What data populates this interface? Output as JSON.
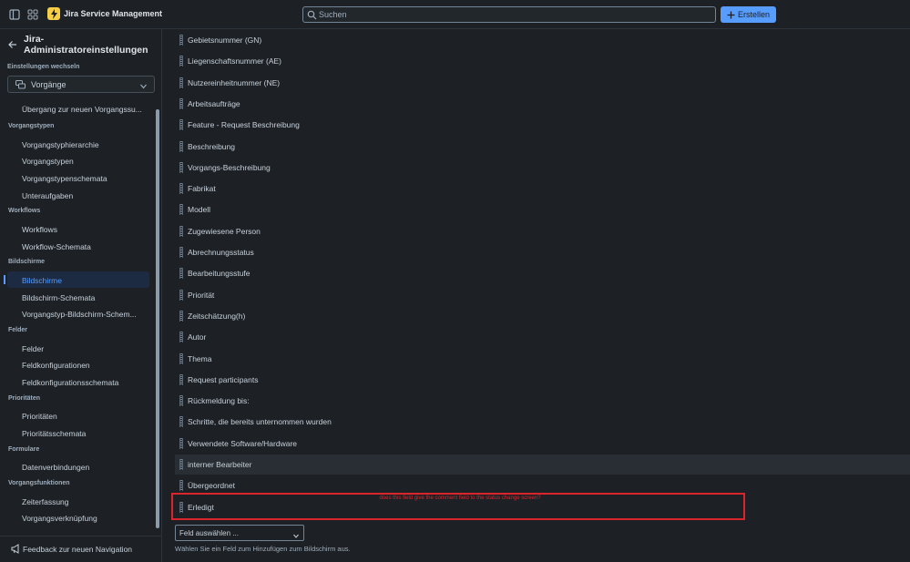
{
  "topbar": {
    "app_name": "Jira Service Management",
    "search_placeholder": "Suchen",
    "create_label": "Erstellen"
  },
  "sidebar": {
    "title": "Jira-Administratoreinstellungen",
    "switch_label": "Einstellungen wechseln",
    "dropdown_value": "Vorgänge",
    "items": [
      {
        "type": "item",
        "label": "Übergang zur neuen Vorgangssu..."
      },
      {
        "type": "section",
        "label": "Vorgangstypen"
      },
      {
        "type": "item",
        "label": "Vorgangstyphierarchie"
      },
      {
        "type": "item",
        "label": "Vorgangstypen"
      },
      {
        "type": "item",
        "label": "Vorgangstypenschemata"
      },
      {
        "type": "item",
        "label": "Unteraufgaben"
      },
      {
        "type": "section",
        "label": "Workflows"
      },
      {
        "type": "item",
        "label": "Workflows"
      },
      {
        "type": "item",
        "label": "Workflow-Schemata"
      },
      {
        "type": "section",
        "label": "Bildschirme"
      },
      {
        "type": "item",
        "label": "Bildschirme",
        "active": true
      },
      {
        "type": "item",
        "label": "Bildschirm-Schemata"
      },
      {
        "type": "item",
        "label": "Vorgangstyp-Bildschirm-Schem..."
      },
      {
        "type": "section",
        "label": "Felder"
      },
      {
        "type": "item",
        "label": "Felder"
      },
      {
        "type": "item",
        "label": "Feldkonfigurationen"
      },
      {
        "type": "item",
        "label": "Feldkonfigurationsschemata"
      },
      {
        "type": "section",
        "label": "Prioritäten"
      },
      {
        "type": "item",
        "label": "Prioritäten"
      },
      {
        "type": "item",
        "label": "Prioritätsschemata"
      },
      {
        "type": "section",
        "label": "Formulare"
      },
      {
        "type": "item",
        "label": "Datenverbindungen"
      },
      {
        "type": "section",
        "label": "Vorgangsfunktionen"
      },
      {
        "type": "item",
        "label": "Zeiterfassung"
      },
      {
        "type": "item",
        "label": "Vorgangsverknüpfung"
      }
    ],
    "feedback_label": "Feedback zur neuen Navigation"
  },
  "fields": [
    "Gebietsnummer (GN)",
    "Liegenschaftsnummer (AE)",
    "Nutzereinheitnummer (NE)",
    "Arbeitsaufträge",
    "Feature - Request Beschreibung",
    "Beschreibung",
    "Vorgangs-Beschreibung",
    "Fabrikat",
    "Modell",
    "Zugewiesene Person",
    "Abrechnungsstatus",
    "Bearbeitungsstufe",
    "Priorität",
    "Zeitschätzung(h)",
    "Autor",
    "Thema",
    "Request participants",
    "Rückmeldung bis:",
    "Schritte, die bereits unternommen wurden",
    "Verwendete Software/Hardware",
    "interner Bearbeiter",
    "Übergeordnet",
    "Erledigt"
  ],
  "annotation": "does this field give the comment field to the status change screen?",
  "add_field": {
    "select_label": "Feld auswählen ...",
    "help": "Wählen Sie ein Feld zum Hinzufügen zum Bildschirm aus."
  },
  "colors": {
    "accent": "#579dff",
    "annotation_red": "#d9252b",
    "logo_yellow": "#f5cd47"
  }
}
